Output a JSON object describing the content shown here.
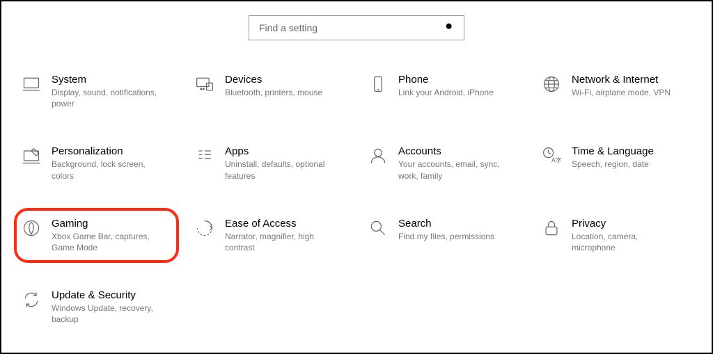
{
  "search": {
    "placeholder": "Find a setting"
  },
  "tiles": [
    {
      "title": "System",
      "desc": "Display, sound, notifications, power"
    },
    {
      "title": "Devices",
      "desc": "Bluetooth, printers, mouse"
    },
    {
      "title": "Phone",
      "desc": "Link your Android, iPhone"
    },
    {
      "title": "Network & Internet",
      "desc": "Wi-Fi, airplane mode, VPN"
    },
    {
      "title": "Personalization",
      "desc": "Background, lock screen, colors"
    },
    {
      "title": "Apps",
      "desc": "Uninstall, defaults, optional features"
    },
    {
      "title": "Accounts",
      "desc": "Your accounts, email, sync, work, family"
    },
    {
      "title": "Time & Language",
      "desc": "Speech, region, date"
    },
    {
      "title": "Gaming",
      "desc": "Xbox Game Bar, captures, Game Mode"
    },
    {
      "title": "Ease of Access",
      "desc": "Narrator, magnifier, high contrast"
    },
    {
      "title": "Search",
      "desc": "Find my files, permissions"
    },
    {
      "title": "Privacy",
      "desc": "Location, camera, microphone"
    },
    {
      "title": "Update & Security",
      "desc": "Windows Update, recovery, backup"
    }
  ]
}
